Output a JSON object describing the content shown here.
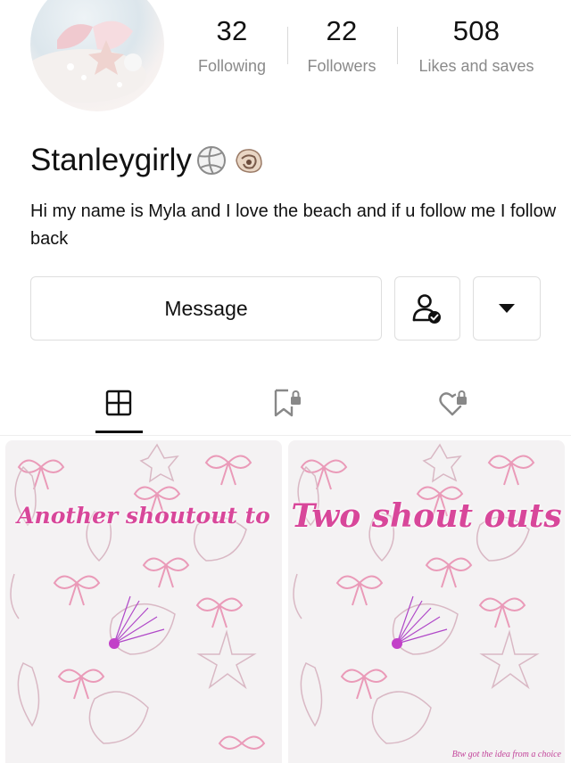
{
  "profile": {
    "avatar_icon": "seashell-avatar-icon",
    "username": "Stanleygirly",
    "username_emojis": [
      "volleyball-icon",
      "shell-icon"
    ],
    "bio": "Hi my name is Myla and I love the beach  and if u follow me I follow back"
  },
  "stats": [
    {
      "value": "32",
      "label": "Following"
    },
    {
      "value": "22",
      "label": "Followers"
    },
    {
      "value": "508",
      "label": "Likes and saves"
    }
  ],
  "actions": {
    "message_label": "Message",
    "follow_icon": "user-check-icon",
    "more_icon": "caret-down-icon"
  },
  "tabs": [
    {
      "icon": "grid-icon",
      "active": true
    },
    {
      "icon": "bookmark-lock-icon",
      "active": false
    },
    {
      "icon": "heart-lock-icon",
      "active": false
    }
  ],
  "posts": [
    {
      "title": "Another shoutout to",
      "footer": ""
    },
    {
      "title": "Two shout outs",
      "footer": "Btw got the idea from a choice"
    }
  ],
  "colors": {
    "accent_pink": "#d8479a",
    "muted_text": "#8a8a8a",
    "border": "#dedede"
  }
}
